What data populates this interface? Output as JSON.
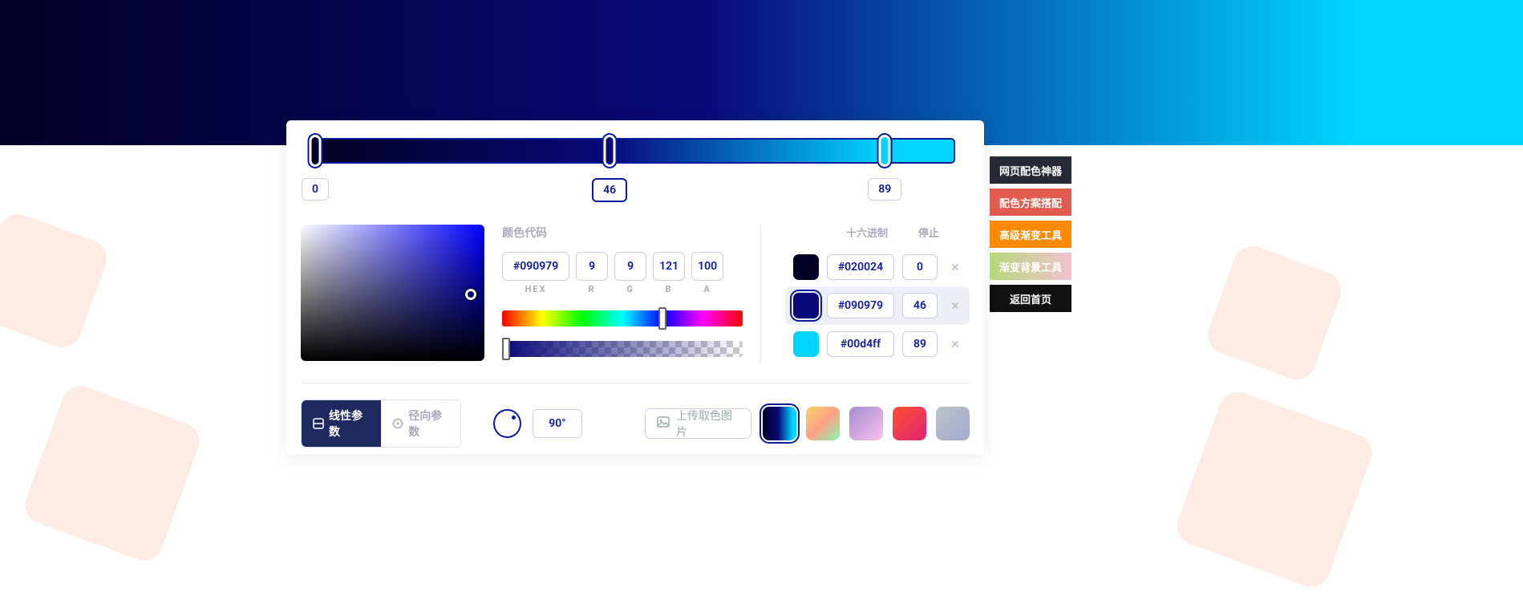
{
  "gradient": {
    "stops": [
      {
        "hex": "#020024",
        "pos": 0
      },
      {
        "hex": "#090979",
        "pos": 46
      },
      {
        "hex": "#00d4ff",
        "pos": 89
      }
    ],
    "selected_index": 1,
    "angle": "90°"
  },
  "color_code": {
    "title": "颜色代码",
    "hex": "#090979",
    "r": 9,
    "g": 9,
    "b": 121,
    "a": 100,
    "labels": {
      "hex": "HEX",
      "r": "R",
      "g": "G",
      "b": "B",
      "a": "A"
    }
  },
  "stops_panel": {
    "head_hex": "十六进制",
    "head_stop": "停止"
  },
  "tabs": {
    "linear": "线性参数",
    "radial": "径向参数"
  },
  "upload_label": "上传取色图片",
  "side_nav": [
    "网页配色神器",
    "配色方案搭配",
    "高级渐变工具",
    "渐变背景工具",
    "返回首页"
  ]
}
